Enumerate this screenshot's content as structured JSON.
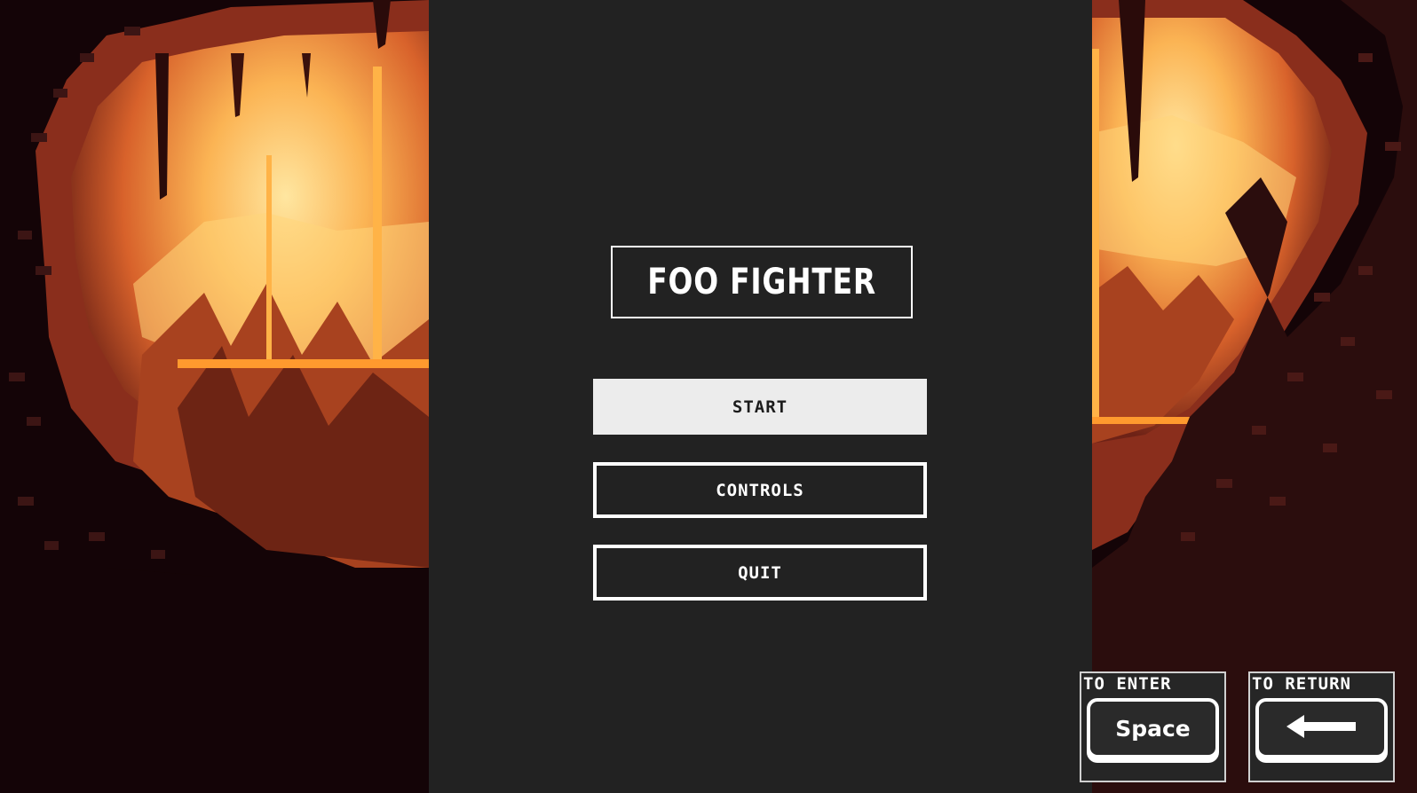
{
  "game": {
    "title": "FOO FIGHTER"
  },
  "menu": {
    "items": [
      {
        "label": "START",
        "selected": true
      },
      {
        "label": "CONTROLS",
        "selected": false
      },
      {
        "label": "QUIT",
        "selected": false
      }
    ]
  },
  "hints": {
    "enter": {
      "caption": "TO ENTER",
      "key_label": "Space"
    },
    "return": {
      "caption": "TO RETURN",
      "key_icon": "left-arrow-icon"
    }
  },
  "colors": {
    "panel": "#222222",
    "border": "#ffffff",
    "selected_bg": "#ececec",
    "selected_text": "#1c1c1c",
    "cave_dark": "#140407",
    "cave_lava": "#f7a13a",
    "cave_glow": "#ffe28a"
  }
}
